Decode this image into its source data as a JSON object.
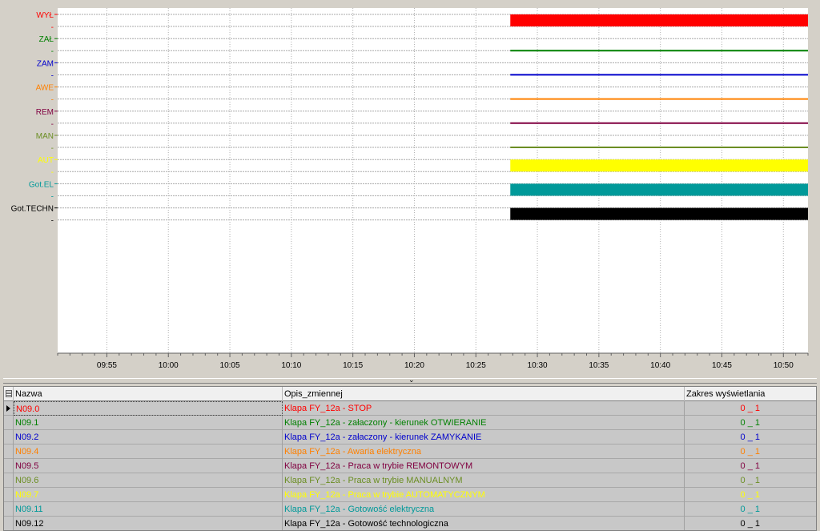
{
  "chart": {
    "signals": [
      {
        "label": "WYŁ",
        "color": "#ff0000",
        "active": 1,
        "thickness": "thick"
      },
      {
        "label": "ZAŁ",
        "color": "#008000",
        "active": 1,
        "thickness": "thin"
      },
      {
        "label": "ZAM",
        "color": "#0000cc",
        "active": 1,
        "thickness": "thin"
      },
      {
        "label": "AWE",
        "color": "#ff8000",
        "active": 1,
        "thickness": "thin"
      },
      {
        "label": "REM",
        "color": "#800040",
        "active": 1,
        "thickness": "thin"
      },
      {
        "label": "MAN",
        "color": "#6b8e23",
        "active": 1,
        "thickness": "thin"
      },
      {
        "label": "AUT",
        "color": "#ffff00",
        "active": 1,
        "thickness": "thick"
      },
      {
        "label": "Got.EL",
        "color": "#009999",
        "active": 1,
        "thickness": "thick"
      },
      {
        "label": "Got.TECHN",
        "color": "#000000",
        "active": 1,
        "thickness": "thick"
      }
    ],
    "time_ticks": [
      "09:55",
      "10:00",
      "10:05",
      "10:10",
      "10:15",
      "10:20",
      "10:25",
      "10:30",
      "10:35",
      "10:40",
      "10:45",
      "10:50"
    ],
    "x_range_minutes": [
      591,
      652
    ],
    "data_start_minutes": 627.8
  },
  "table": {
    "headers": [
      "Nazwa",
      "Opis_zmiennej",
      "Zakres wyświetlania"
    ],
    "rows": [
      {
        "name": "N09.0",
        "desc": "Klapa FY_12a -  STOP",
        "range": "0 _ 1",
        "color": "#ff0000",
        "range_color": "#ff0000"
      },
      {
        "name": "N09.1",
        "desc": "Klapa FY_12a -  załaczony - kierunek OTWIERANIE",
        "range": "0 _ 1",
        "color": "#008000",
        "range_color": "#008000"
      },
      {
        "name": "N09.2",
        "desc": "Klapa FY_12a -  załaczony - kierunek ZAMYKANIE",
        "range": "0 _ 1",
        "color": "#0000cc",
        "range_color": "#0000cc"
      },
      {
        "name": "N09.4",
        "desc": "Klapa FY_12a - Awaria elektryczna",
        "range": "0 _ 1",
        "color": "#ff8000",
        "range_color": "#ff8000"
      },
      {
        "name": "N09.5",
        "desc": "Klapa FY_12a - Praca w trybie REMONTOWYM",
        "range": "0 _ 1",
        "color": "#800040",
        "range_color": "#800040"
      },
      {
        "name": "N09.6",
        "desc": "Klapa FY_12a - Praca w trybie MANUALNYM",
        "range": "0 _ 1",
        "color": "#6b8e23",
        "range_color": "#6b8e23"
      },
      {
        "name": "N09.7",
        "desc": "Klapa FY_12a - Praca w trybie AUTOMATYCZNYM",
        "range": "0 _ 1",
        "color": "#ffff00",
        "range_color": "#ffff00"
      },
      {
        "name": "N09.11",
        "desc": "Klapa FY_12a - Gotowość elektryczna",
        "range": "0 _ 1",
        "color": "#009999",
        "range_color": "#009999"
      },
      {
        "name": "N09.12",
        "desc": "Klapa FY_12a - Gotowość technologiczna",
        "range": "0 _ 1",
        "color": "#000000",
        "range_color": "#000000"
      }
    ]
  },
  "icons": {
    "splitter": "chevron-down-icon",
    "row_marker": "row-pointer-icon",
    "header": "grid-icon"
  }
}
